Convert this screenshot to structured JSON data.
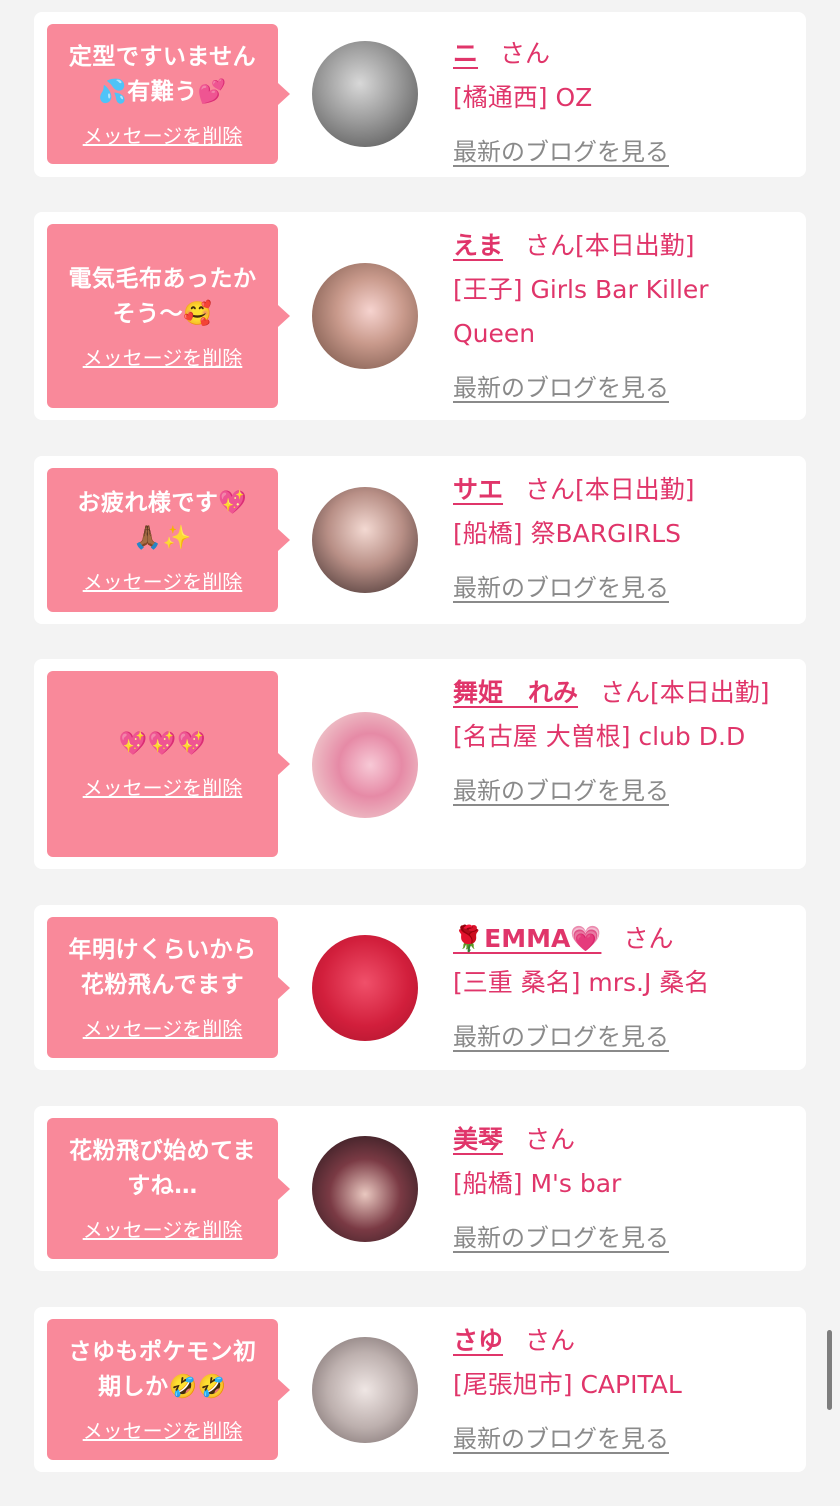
{
  "san_label": "さん",
  "delete_label": "メッセージを削除",
  "blog_label": "最新のブログを見る",
  "colors": {
    "background": "#f3f3f3",
    "bubble": "#f9899a",
    "name": "#e0356a",
    "blog_link": "#8a8a8a"
  },
  "cards": [
    {
      "message": "定型ですいません\n💦有難う💕",
      "name": "ニ",
      "status": "",
      "shop": "[橘通西] OZ"
    },
    {
      "message": "電気毛布あったか\nそう～🥰",
      "name": "えま",
      "status": "[本日出勤]",
      "shop": "[王子] Girls Bar Killer Queen"
    },
    {
      "message": "お疲れ様です💖\n🙏🏾✨",
      "name": "サエ",
      "status": "[本日出勤]",
      "shop": "[船橋] 祭BARGIRLS"
    },
    {
      "message": "💖💖💖",
      "name": "舞姫　れみ",
      "status": "[本日出勤]",
      "shop": "[名古屋 大曽根] club D.D"
    },
    {
      "message": "年明けくらいから\n花粉飛んでます",
      "name": "🌹EMMA💗",
      "status": "",
      "shop": "[三重 桑名] mrs.J 桑名"
    },
    {
      "message": "花粉飛び始めてま\nすね…",
      "name": "美琴",
      "status": "",
      "shop": "[船橋] M's bar"
    },
    {
      "message": "さゆもポケモン初\n期しか🤣🤣",
      "name": "さゆ",
      "status": "",
      "shop": "[尾張旭市] CAPITAL"
    }
  ]
}
